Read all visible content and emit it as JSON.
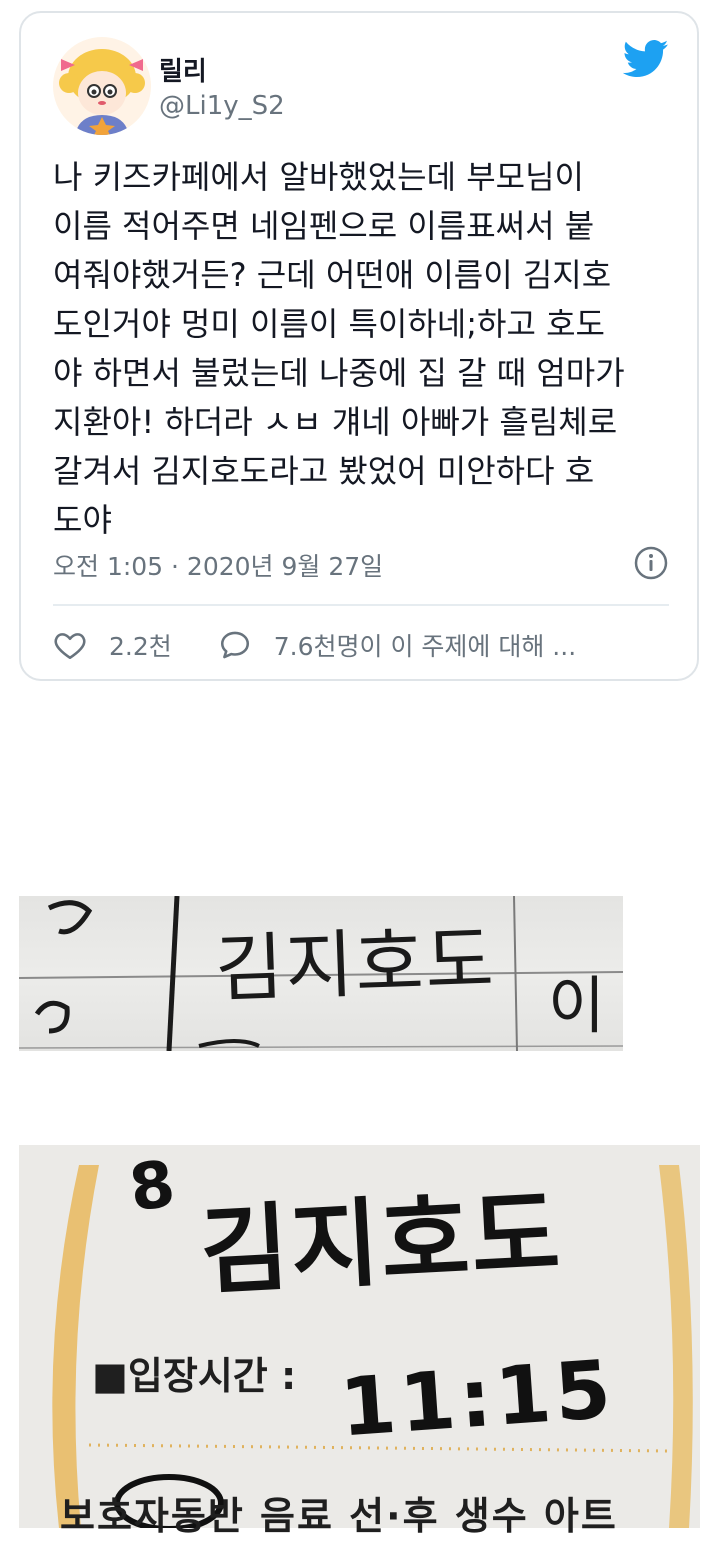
{
  "tweet": {
    "display_name": "릴리",
    "handle": "@Li1y_S2",
    "text": "나 키즈카페에서 알바했었는데 부모님이\n이름 적어주면 네임펜으로 이름표써서 붙\n여줘야했거든? 근데 어떤애 이름이 김지호\n도인거야 멍미 이름이 특이하네;하고 호도\n야 하면서 불렀는데 나중에 집 갈 때 엄마가\n지환아! 하더라 ㅅㅂ 걔네 아빠가 흘림체로\n갈겨서 김지호도라고 봤었어 미안하다 호\n도야",
    "timestamp": "오전 1:05 · 2020년 9월 27일",
    "likes": "2.2천",
    "discussion": "7.6천명이 이 주제에 대해 ...",
    "accent_color": "#1da1f2",
    "icons": [
      "twitter-bird-icon",
      "info-icon",
      "heart-icon",
      "speech-bubble-icon"
    ]
  },
  "photo1": {
    "handwritten_name": "김지호도",
    "side_text": "이"
  },
  "photo2": {
    "number": "8",
    "handwritten_name": "김지호도",
    "entry_label": "■입장시간 :",
    "entry_time": "11:15",
    "footer": "보호자동반 음료 선·후 생수 아트"
  }
}
